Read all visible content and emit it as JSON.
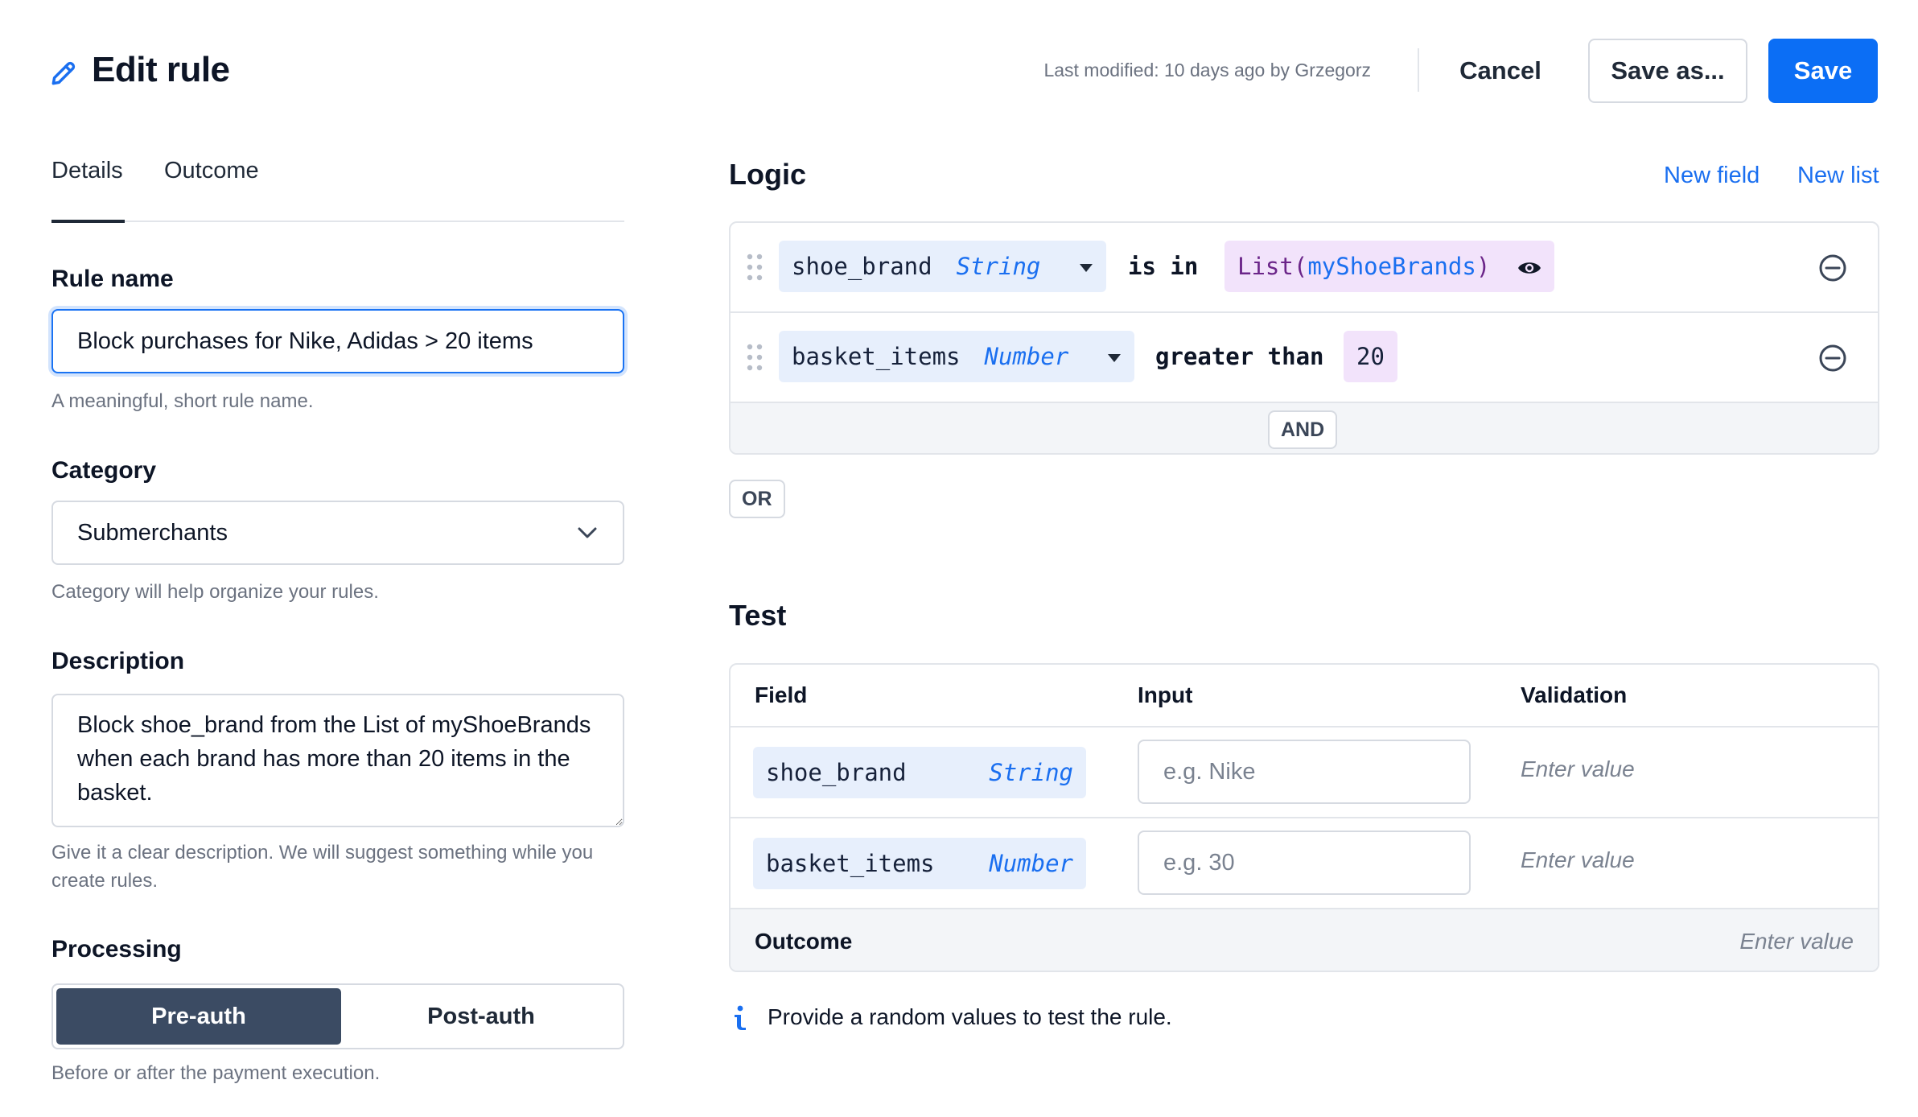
{
  "header": {
    "title": "Edit rule",
    "last_modified": "Last modified: 10 days ago by Grzegorz",
    "cancel_label": "Cancel",
    "save_as_label": "Save as...",
    "save_label": "Save"
  },
  "colors": {
    "accent": "#0b6ef5",
    "selected_segment": "#3b4b63",
    "field_pill_bg": "#e7effc",
    "value_pill_bg": "#f2e3fb"
  },
  "tabs": [
    {
      "label": "Details",
      "active": true
    },
    {
      "label": "Outcome",
      "active": false
    }
  ],
  "form": {
    "rule_name": {
      "label": "Rule name",
      "value": "Block purchases for Nike, Adidas > 20 items",
      "help": "A meaningful, short rule name."
    },
    "category": {
      "label": "Category",
      "value": "Submerchants",
      "help": "Category will help organize your rules."
    },
    "description": {
      "label": "Description",
      "value": "Block shoe_brand from the List of myShoeBrands when each brand has more than 20 items in the basket.",
      "help": "Give it a clear description. We will suggest something while you create rules."
    },
    "processing": {
      "label": "Processing",
      "options": [
        "Pre-auth",
        "Post-auth"
      ],
      "selected": "Pre-auth",
      "help": "Before or after the payment execution."
    }
  },
  "logic": {
    "title": "Logic",
    "new_field_label": "New field",
    "new_list_label": "New list",
    "conditions": [
      {
        "field": "shoe_brand",
        "type": "String",
        "operator": "is in",
        "value_prefix": "List(",
        "value_name": "myShoeBrands",
        "value_suffix": ")"
      },
      {
        "field": "basket_items",
        "type": "Number",
        "operator": "greater than",
        "value": "20"
      }
    ],
    "and_label": "AND",
    "or_label": "OR"
  },
  "test": {
    "title": "Test",
    "columns": [
      "Field",
      "Input",
      "Validation"
    ],
    "rows": [
      {
        "field": "shoe_brand",
        "type": "String",
        "placeholder": "e.g. Nike",
        "validation": "Enter value"
      },
      {
        "field": "basket_items",
        "type": "Number",
        "placeholder": "e.g. 30",
        "validation": "Enter value"
      }
    ],
    "outcome_label": "Outcome",
    "outcome_value": "Enter value",
    "info_text": "Provide a random values to test the rule."
  },
  "icons": [
    "pencil-icon",
    "chevron-down-icon",
    "drag-handle-icon",
    "caret-down-icon",
    "eye-icon",
    "remove-circle-icon",
    "info-icon"
  ]
}
